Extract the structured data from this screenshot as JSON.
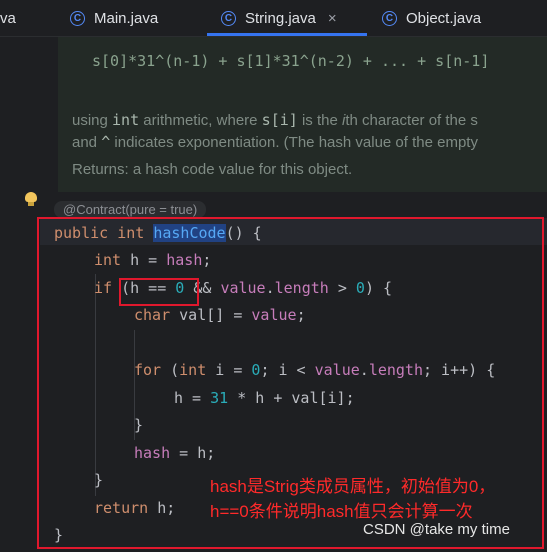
{
  "tabs": [
    {
      "label": "va"
    },
    {
      "label": "Main.java"
    },
    {
      "label": "String.java",
      "active": true,
      "close": "×"
    },
    {
      "label": "Object.java"
    }
  ],
  "tab_icon_letter": "C",
  "doc": {
    "formula": "s[0]*31^(n-1) + s[1]*31^(n-2) + ... + s[n-1]",
    "line1": [
      "using ",
      "int",
      " arithmetic, where ",
      "s[i]",
      " is the ",
      "i",
      "th character of the s"
    ],
    "line2": [
      "and ",
      "^",
      " indicates exponentiation. (The hash value of the empty"
    ],
    "returns": "Returns: a hash code value for this object."
  },
  "contract_hint": "@Contract(pure = true)",
  "code": {
    "l1": [
      "public",
      " ",
      "int",
      " ",
      "hashCode",
      "() {"
    ],
    "l2": [
      "int",
      " h = ",
      "hash",
      ";"
    ],
    "l3": [
      "if",
      " (h == ",
      "0",
      " && ",
      "value",
      ".",
      "length",
      " > ",
      "0",
      ") {"
    ],
    "l4": [
      "char",
      " val[] = ",
      "value",
      ";"
    ],
    "l5": [
      "for",
      " (",
      "int",
      " i = ",
      "0",
      "; i < ",
      "value",
      ".",
      "length",
      "; i++) {"
    ],
    "l6": [
      "h = ",
      "31",
      " * h + val[i];"
    ],
    "l7": "}",
    "l8": [
      "hash",
      " = h;"
    ],
    "l9": "}",
    "l10": [
      "return",
      " h;"
    ],
    "l11": "}"
  },
  "annotation": {
    "line1": "hash是Strig类成员属性，初始值为0，",
    "line2": "h==0条件说明hash值只会计算一次"
  },
  "watermark": "CSDN @take my time",
  "colors": {
    "accent": "#3574f0",
    "annotation_red": "#e0182d",
    "keyword": "#cf8e6d",
    "field": "#c77dbb",
    "number": "#2aacb8",
    "method": "#56a8f5"
  }
}
